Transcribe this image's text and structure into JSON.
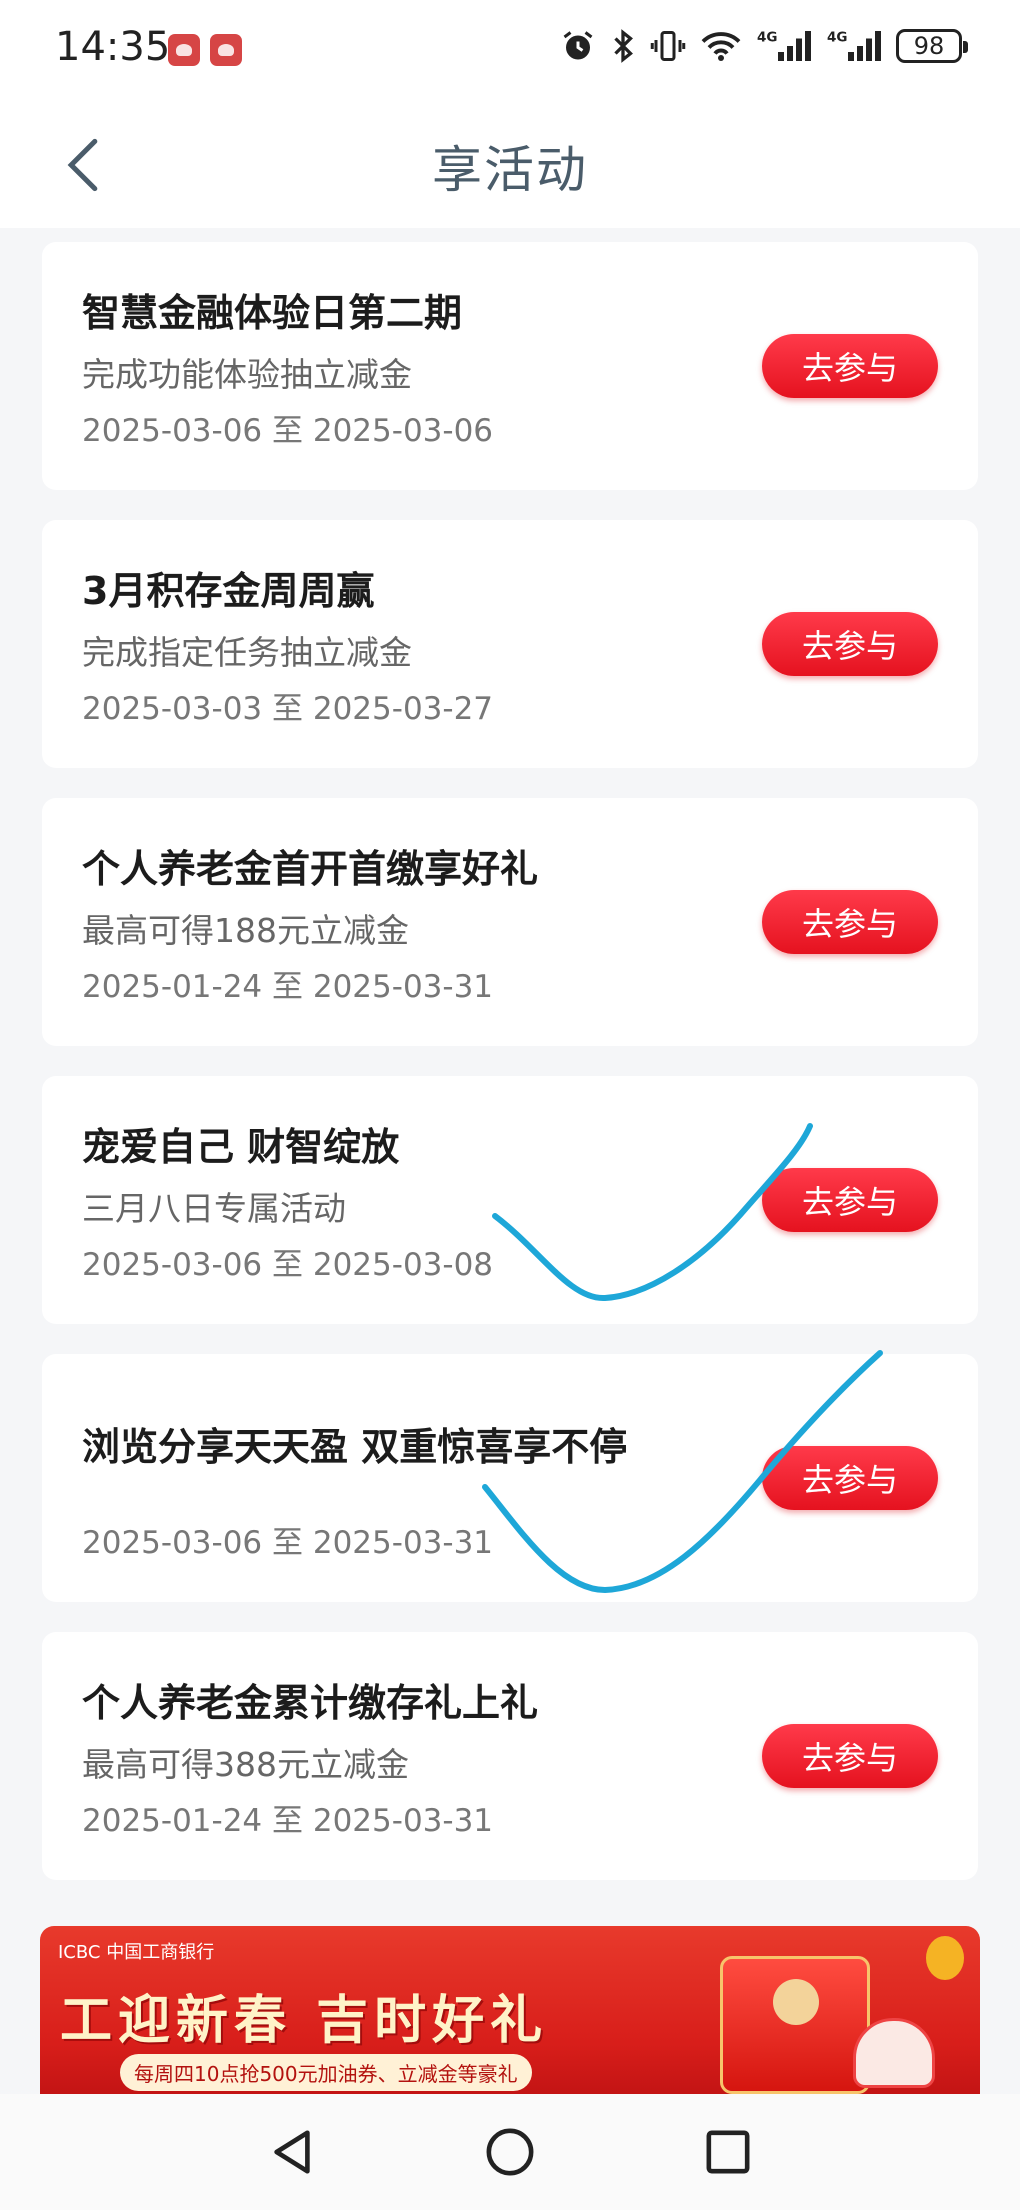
{
  "status_bar": {
    "time": "14:35",
    "battery": "98",
    "icons": [
      "app-badge-icon",
      "app-badge-icon",
      "alarm-icon",
      "bluetooth-icon",
      "vibrate-icon",
      "wifi-icon",
      "signal-4g-icon",
      "signal-4g-icon",
      "battery-icon"
    ],
    "network_label": "4G"
  },
  "header": {
    "title": "享活动",
    "back_icon": "chevron-left-icon"
  },
  "activities": [
    {
      "title": "智慧金融体验日第二期",
      "desc": "完成功能体验抽立减金",
      "date": "2025-03-06 至 2025-03-06",
      "button": "去参与"
    },
    {
      "title": "3月积存金周周赢",
      "desc": "完成指定任务抽立减金",
      "date": "2025-03-03 至 2025-03-27",
      "button": "去参与"
    },
    {
      "title": "个人养老金首开首缴享好礼",
      "desc": "最高可得188元立减金",
      "date": "2025-01-24 至 2025-03-31",
      "button": "去参与"
    },
    {
      "title": "宠爱自己 财智绽放",
      "desc": "三月八日专属活动",
      "date": "2025-03-06 至 2025-03-08",
      "button": "去参与"
    },
    {
      "title": "浏览分享天天盈 双重惊喜享不停",
      "desc": "",
      "date": "2025-03-06 至 2025-03-31",
      "button": "去参与"
    },
    {
      "title": "个人养老金累计缴存礼上礼",
      "desc": "最高可得388元立减金",
      "date": "2025-01-24 至 2025-03-31",
      "button": "去参与"
    }
  ],
  "annotations": {
    "checkmark_color": "#1ea7d8",
    "checkmark_icon": "checkmark-icon"
  },
  "banner": {
    "brand": "ICBC 中国工商银行",
    "headline": "工迎新春 吉时好礼",
    "subline": "每周四10点抢500元加油券、立减金等豪礼"
  },
  "nav_bar": {
    "icons": [
      "back-triangle-icon",
      "home-circle-icon",
      "recents-square-icon"
    ]
  },
  "colors": {
    "accent_red": "#e5121f",
    "title_color": "#4a5c6a",
    "page_bg": "#f5f6f8"
  }
}
